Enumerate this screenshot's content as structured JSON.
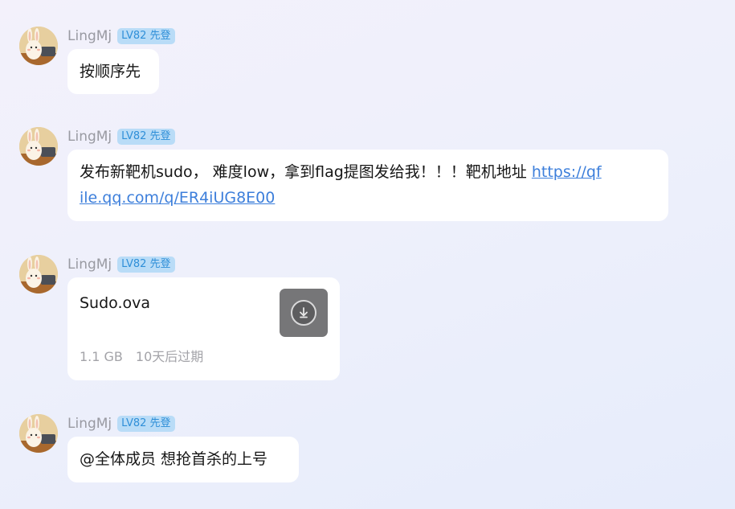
{
  "messages": [
    {
      "sender": "LingMj",
      "badge": "LV82 先登",
      "text": "按顺序先"
    },
    {
      "sender": "LingMj",
      "badge": "LV82 先登",
      "text": "发布新靶机sudo， 难度low，拿到flag提图发给我！！！靶机地址",
      "link": "https://qfile.qq.com/q/ER4iUG8E00",
      "link_line1": "https://qf",
      "link_line2": "ile.qq.com/q/ER4iUG8E00"
    },
    {
      "sender": "LingMj",
      "badge": "LV82 先登",
      "file": {
        "name": "Sudo.ova",
        "size": "1.1 GB",
        "expiry": "10天后过期",
        "icon": "download-icon"
      }
    },
    {
      "sender": "LingMj",
      "badge": "LV82 先登",
      "text": "@全体成员 想抢首杀的上号"
    }
  ]
}
